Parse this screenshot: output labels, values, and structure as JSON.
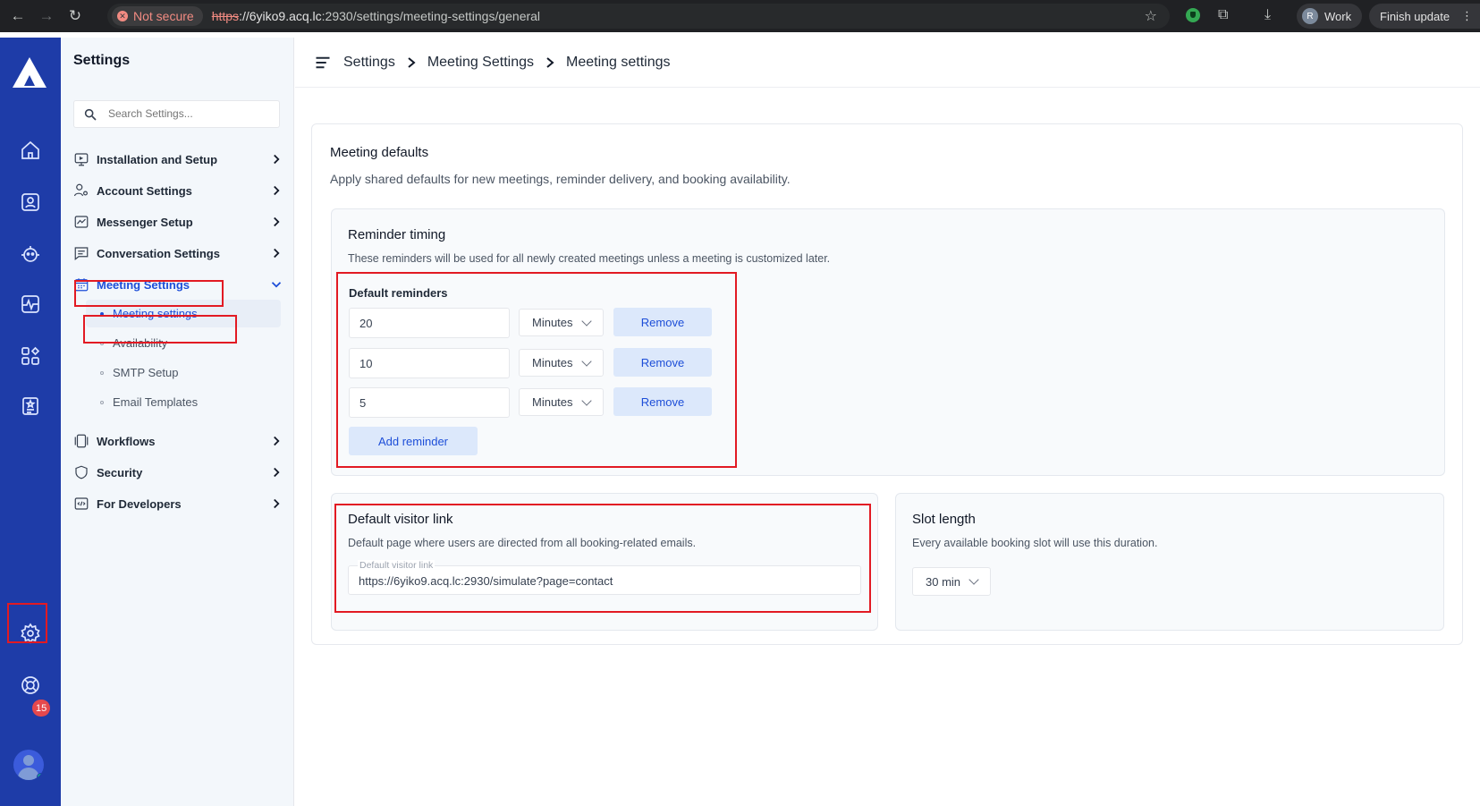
{
  "browser": {
    "security_label": "Not secure",
    "url_scheme": "https",
    "url_host": "://6yiko9.acq.lc",
    "url_rest": ":2930/settings/meeting-settings/general",
    "profile_initial": "R",
    "profile_label": "Work",
    "update_label": "Finish update"
  },
  "rail": {
    "notification_count": "15"
  },
  "sidebar": {
    "title": "Settings",
    "search_placeholder": "Search Settings...",
    "items": [
      {
        "label": "Installation and Setup",
        "icon": "monitor-icon"
      },
      {
        "label": "Account Settings",
        "icon": "user-gear-icon"
      },
      {
        "label": "Messenger Setup",
        "icon": "chart-icon"
      },
      {
        "label": "Conversation Settings",
        "icon": "message-icon"
      },
      {
        "label": "Meeting Settings",
        "icon": "calendar-icon"
      },
      {
        "label": "Workflows",
        "icon": "workflow-icon"
      },
      {
        "label": "Security",
        "icon": "shield-icon"
      },
      {
        "label": "For Developers",
        "icon": "code-icon"
      }
    ],
    "sub_items": [
      {
        "label": "Meeting settings"
      },
      {
        "label": "Availability"
      },
      {
        "label": "SMTP Setup"
      },
      {
        "label": "Email Templates"
      }
    ]
  },
  "breadcrumb": [
    "Settings",
    "Meeting Settings",
    "Meeting settings"
  ],
  "main": {
    "title": "Meeting defaults",
    "description": "Apply shared defaults for new meetings, reminder delivery, and booking availability.",
    "reminder_card": {
      "title": "Reminder timing",
      "description": "These reminders will be used for all newly created meetings unless a meeting is customized later.",
      "label": "Default reminders",
      "reminders": [
        {
          "value": "20",
          "unit": "Minutes"
        },
        {
          "value": "10",
          "unit": "Minutes"
        },
        {
          "value": "5",
          "unit": "Minutes"
        }
      ],
      "remove_label": "Remove",
      "add_label": "Add reminder"
    },
    "visitor_card": {
      "title": "Default visitor link",
      "description": "Default page where users are directed from all booking-related emails.",
      "field_label": "Default visitor link",
      "field_value": "https://6yiko9.acq.lc:2930/simulate?page=contact"
    },
    "slot_card": {
      "title": "Slot length",
      "description": "Every available booking slot will use this duration.",
      "value": "30 min"
    }
  },
  "colors": {
    "rail": "#1e3ca8",
    "accent": "#1d4ed8",
    "highlight": "#e21a23"
  }
}
